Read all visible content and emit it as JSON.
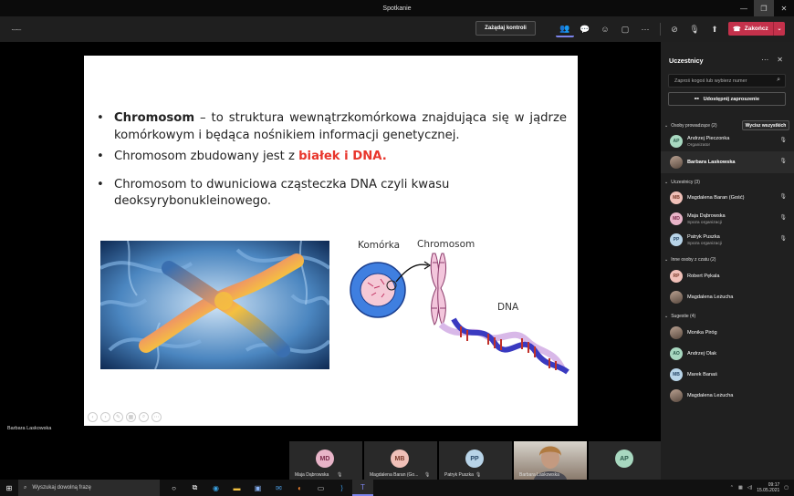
{
  "window": {
    "title": "Spotkanie"
  },
  "toolbar": {
    "request_control": "Zażądaj kontroli",
    "end_call": "Zakończ"
  },
  "slide": {
    "b1_bold": "Chromosom",
    "b1_rest": " – to struktura wewnątrzkomórkowa znajdująca się w jądrze komórkowym i będąca nośnikiem informacji genetycznej.",
    "b2_pre": "Chromosom zbudowany jest z ",
    "b2_red": "białek i DNA",
    "b2_post": ".",
    "b3": "Chromosom to dwuniciowa cząsteczka DNA czyli kwasu deoksyrybonukleinowego.",
    "diagram": {
      "cell": "Komórka",
      "chromosome": "Chromosom",
      "dna": "DNA"
    }
  },
  "presenter": "Barbara Laskowska",
  "strip": [
    {
      "initials": "MD",
      "name": "Maja Dąbrowska",
      "color": "#e8b4c8"
    },
    {
      "initials": "MB",
      "name": "Magdalena Baran (Go...",
      "color": "#f0c0b8"
    },
    {
      "initials": "PP",
      "name": "Patryk Puszka",
      "color": "#b8d4e8"
    },
    {
      "initials": "",
      "name": "Barbara Laskowska",
      "color": "#888"
    },
    {
      "initials": "AP",
      "name": "",
      "color": "#a8d8c0"
    }
  ],
  "panel": {
    "title": "Uczestnicy",
    "search_placeholder": "Zaproś kogoś lub wybierz numer",
    "share": "Udostępnij zaproszenie",
    "mute_all": "Wycisz wszystkich",
    "sections": {
      "presenters": "Osoby prowadzące (2)",
      "attendees": "Uczestnicy (3)",
      "chat": "Inne osoby z czatu (2)",
      "suggestions": "Sugestie (4)"
    },
    "presenters": [
      {
        "initials": "AP",
        "name": "Andrzej Pieczonka",
        "sub": "Organizator",
        "color": "#a8d8c0"
      },
      {
        "initials": "BL",
        "name": "Barbara Laskowska",
        "sub": "",
        "color": "#a8d8c0"
      }
    ],
    "attendees": [
      {
        "initials": "MB",
        "name": "Magdalena Baran (Gość)",
        "sub": "",
        "color": "#f0c0b8"
      },
      {
        "initials": "MD",
        "name": "Maja Dąbrowska",
        "sub": "Spoza organizacji",
        "color": "#e8b4c8"
      },
      {
        "initials": "PP",
        "name": "Patryk Puszka",
        "sub": "Spoza organizacji",
        "color": "#b8d4e8"
      }
    ],
    "chat": [
      {
        "initials": "RP",
        "name": "Robert Pękala",
        "color": "#f0c0b8"
      },
      {
        "initials": "",
        "name": "Magdalena Leżucha",
        "color": "#888"
      }
    ],
    "suggestions": [
      {
        "initials": "",
        "name": "Monika Piróg",
        "color": "#888"
      },
      {
        "initials": "AO",
        "name": "Andrzej Olak",
        "color": "#a8d8c0"
      },
      {
        "initials": "MB",
        "name": "Marek Banaś",
        "color": "#b8d4e8"
      },
      {
        "initials": "",
        "name": "Magdalena Leżucha",
        "color": "#888"
      }
    ]
  },
  "taskbar": {
    "search": "Wyszukaj dowolną frazę",
    "time": "09:17",
    "date": "15.05.2021"
  }
}
